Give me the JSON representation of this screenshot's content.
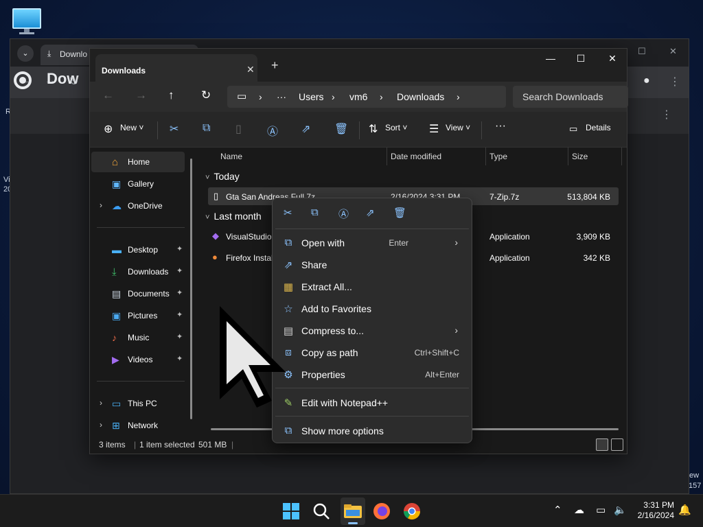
{
  "desktop": {
    "side_text_left_1": "R",
    "side_text_left_2": "Vi",
    "side_text_left_3": "20",
    "side_text_right_1": "ew",
    "side_text_right_2": "157"
  },
  "chrome": {
    "tab_title": "Downlo",
    "page_title": "Dow"
  },
  "explorer": {
    "tab_title": "Downloads",
    "breadcrumb": [
      "Users",
      "vm6",
      "Downloads"
    ],
    "search_placeholder": "Search Downloads",
    "commands": {
      "new": "New",
      "sort": "Sort",
      "view": "View",
      "details": "Details"
    },
    "nav": {
      "home": "Home",
      "gallery": "Gallery",
      "onedrive": "OneDrive",
      "desktop": "Desktop",
      "downloads": "Downloads",
      "documents": "Documents",
      "pictures": "Pictures",
      "music": "Music",
      "videos": "Videos",
      "thispc": "This PC",
      "network": "Network"
    },
    "columns": {
      "name": "Name",
      "date": "Date modified",
      "type": "Type",
      "size": "Size"
    },
    "groups": {
      "today": "Today",
      "last_month": "Last month"
    },
    "files": [
      {
        "name": "Gta San Andreas Full.7z",
        "date": "2/16/2024 3:31 PM",
        "type": "7-Zip.7z",
        "size": "513,804 KB"
      },
      {
        "name": "VisualStudioS",
        "date": "",
        "type": "Application",
        "size": "3,909 KB"
      },
      {
        "name": "Firefox Instal",
        "date": "",
        "type": "Application",
        "size": "342 KB"
      }
    ],
    "status": {
      "items": "3 items",
      "selected": "1 item selected",
      "size": "501 MB"
    }
  },
  "context_menu": {
    "items": [
      {
        "label": "Open with",
        "shortcut": "Enter"
      },
      {
        "label": "Share",
        "shortcut": ""
      },
      {
        "label": "Extract All...",
        "shortcut": ""
      },
      {
        "label": "Add to Favorites",
        "shortcut": ""
      },
      {
        "label": "Compress to...",
        "shortcut": ""
      },
      {
        "label": "Copy as path",
        "shortcut": "Ctrl+Shift+C"
      },
      {
        "label": "Properties",
        "shortcut": "Alt+Enter"
      },
      {
        "label": "Edit with Notepad++",
        "shortcut": ""
      },
      {
        "label": "Show more options",
        "shortcut": ""
      }
    ]
  },
  "taskbar": {
    "time": "3:31 PM",
    "date": "2/16/2024"
  }
}
